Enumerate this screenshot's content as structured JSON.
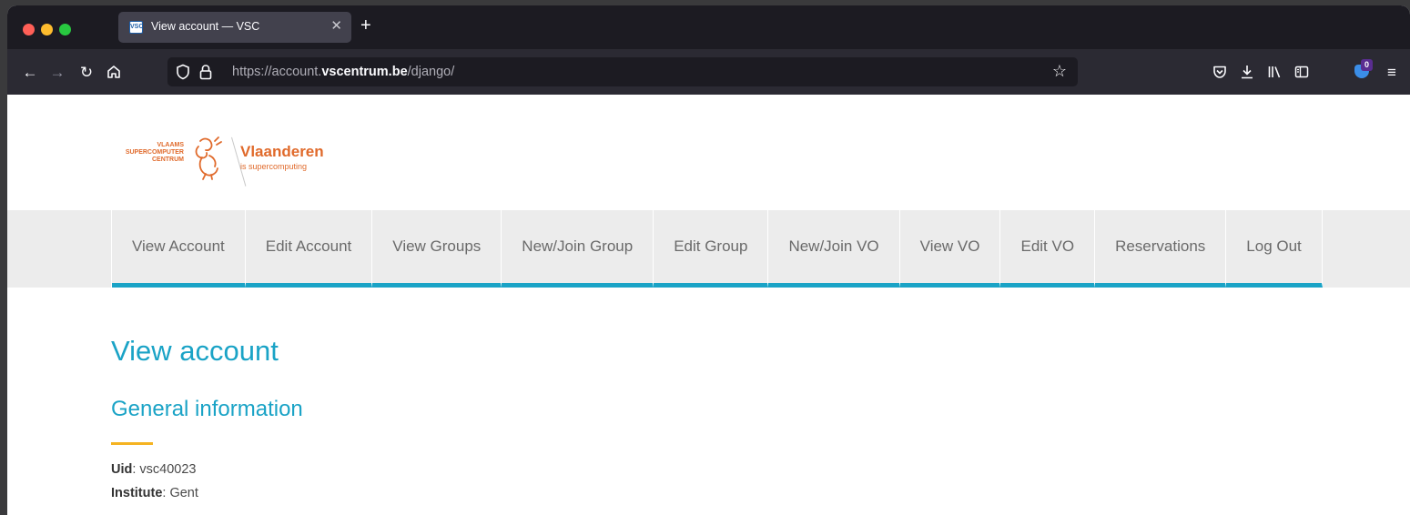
{
  "browser": {
    "tab_title": "View account — VSC",
    "tab_favicon_text": "VSC",
    "url_prefix": "https://account.",
    "url_host": "vscentrum.be",
    "url_path": "/django/",
    "extension_badge_count": "0"
  },
  "logo": {
    "left_line1": "VLAAMS",
    "left_line2": "SUPERCOMPUTER",
    "left_line3": "CENTRUM",
    "title": "Vlaanderen",
    "tagline": "is supercomputing",
    "brand_color": "#e06a2b"
  },
  "menu": {
    "items": [
      {
        "label": "View Account"
      },
      {
        "label": "Edit Account"
      },
      {
        "label": "View Groups"
      },
      {
        "label": "New/Join Group"
      },
      {
        "label": "Edit Group"
      },
      {
        "label": "New/Join VO"
      },
      {
        "label": "View VO"
      },
      {
        "label": "Edit VO"
      },
      {
        "label": "Reservations"
      },
      {
        "label": "Log Out"
      }
    ],
    "accent_color": "#1aa3c6"
  },
  "main": {
    "page_title": "View account",
    "section_title": "General information",
    "fields": [
      {
        "label": "Uid",
        "value": "vsc40023"
      },
      {
        "label": "Institute",
        "value": "Gent"
      }
    ]
  }
}
